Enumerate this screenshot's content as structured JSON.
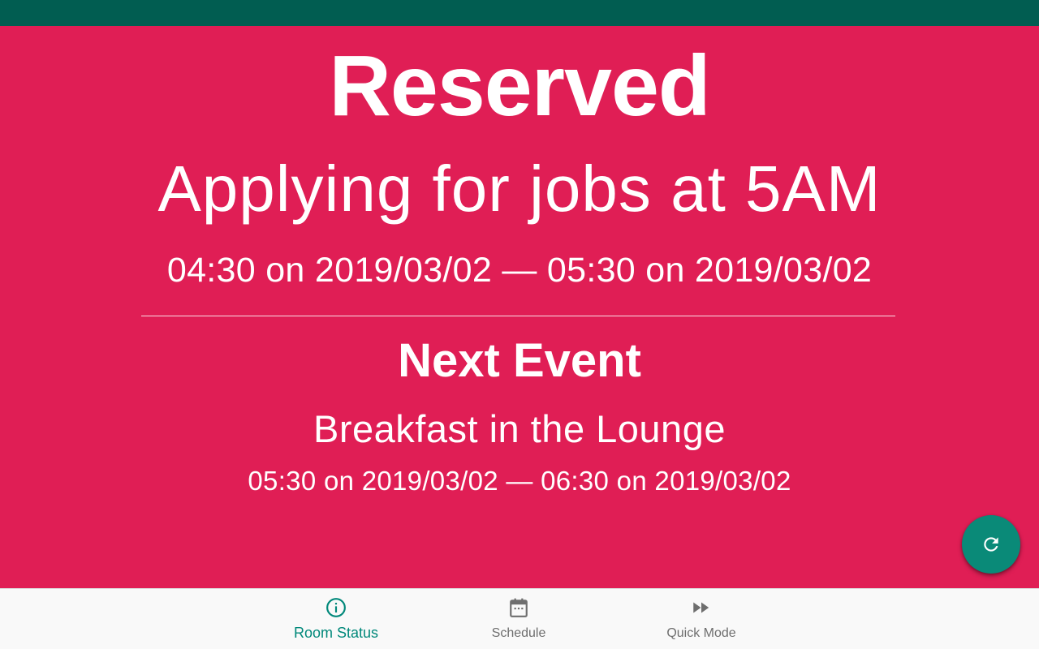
{
  "room": {
    "status": "Reserved",
    "current_event": {
      "title": "Applying for jobs at 5AM",
      "time_range": "04:30 on 2019/03/02 — 05:30 on 2019/03/02"
    },
    "next_event": {
      "heading": "Next Event",
      "title": "Breakfast in the Lounge",
      "time_range": "05:30 on 2019/03/02 — 06:30 on 2019/03/02"
    }
  },
  "fab": {
    "icon": "refresh-icon"
  },
  "bottom_nav": {
    "items": [
      {
        "label": "Room Status",
        "icon": "info-icon",
        "active": true
      },
      {
        "label": "Schedule",
        "icon": "calendar-icon",
        "active": false
      },
      {
        "label": "Quick Mode",
        "icon": "fast-forward-icon",
        "active": false
      }
    ]
  },
  "colors": {
    "status_bar": "#015d51",
    "background_reserved": "#e01e55",
    "accent": "#00887a",
    "nav_inactive": "#6e6e6e",
    "nav_background": "#f9f9f9"
  }
}
